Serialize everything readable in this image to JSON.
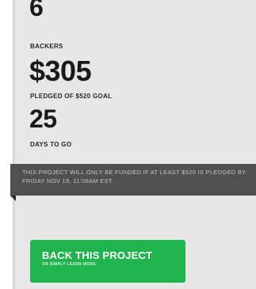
{
  "stats": {
    "backers": {
      "value": "6",
      "label": "BACKERS"
    },
    "pledged": {
      "value": "$305",
      "label": "PLEDGED OF $520 GOAL"
    },
    "days": {
      "value": "25",
      "label": "DAYS TO GO"
    }
  },
  "notice": {
    "text": "THIS PROJECT WILL ONLY BE FUNDED IF AT LEAST $520 IS PLEDGED BY FRIDAY NOV 19, 11:56AM EST."
  },
  "cta": {
    "label": "BACK THIS PROJECT",
    "sublabel": "OR SIMPLY LEARN MORE"
  },
  "colors": {
    "button_green": "#21b34e",
    "notice_background": "#505050",
    "panel_background": "#e7e7e7"
  }
}
